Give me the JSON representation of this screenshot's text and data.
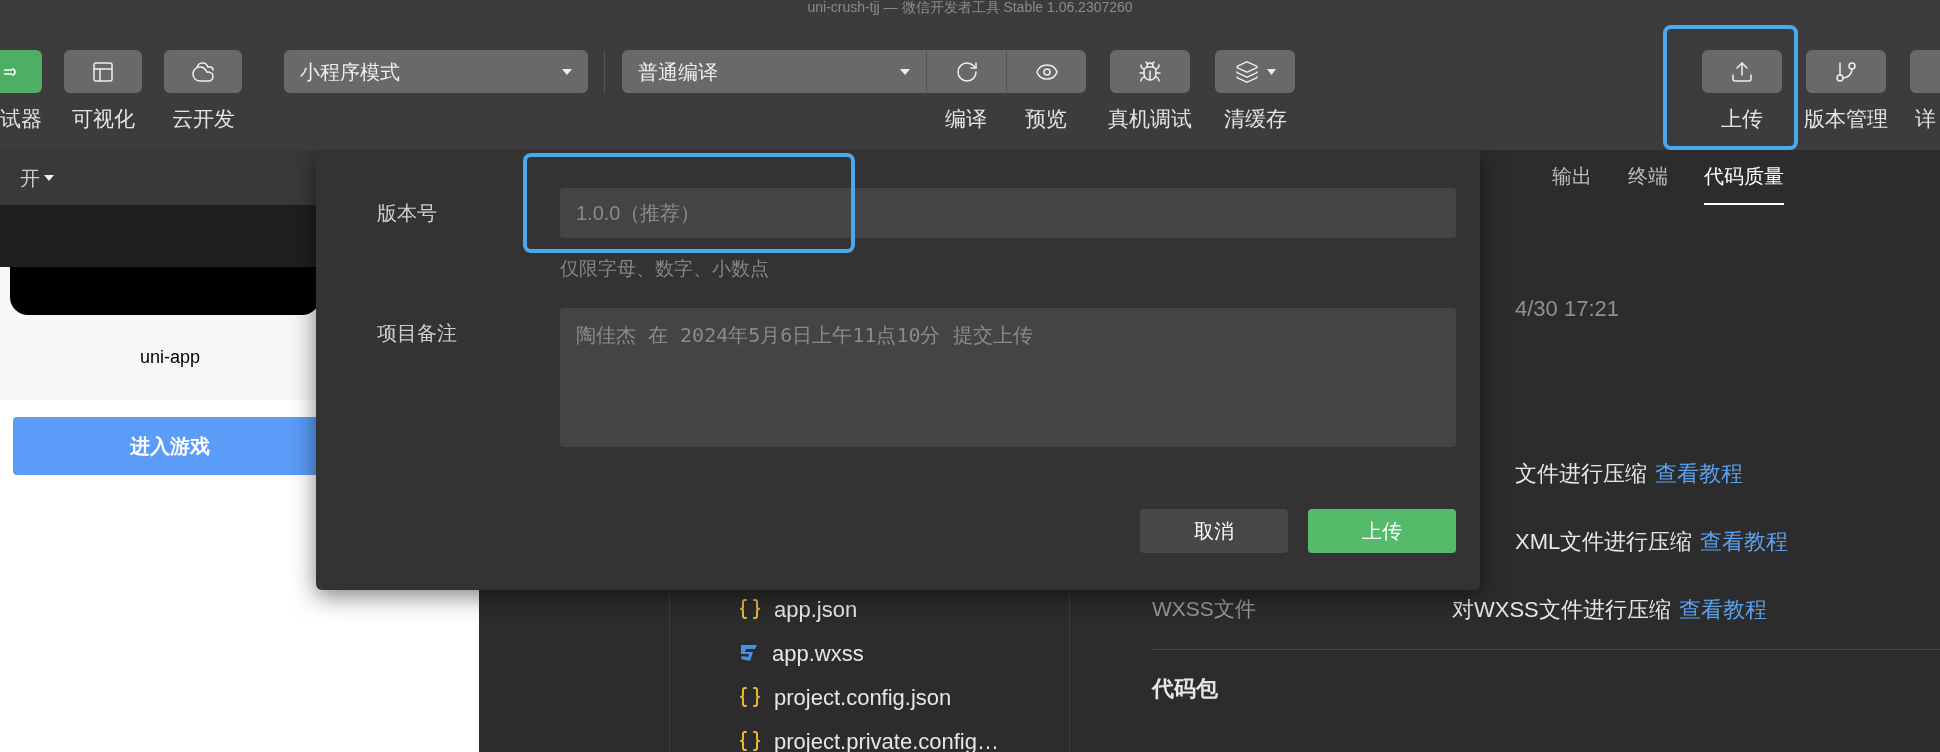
{
  "window": {
    "title": "uni-crush-tjj — 微信开发者工具 Stable 1.06.2307260"
  },
  "toolbar": {
    "left_buttons": [
      {
        "label": "试器",
        "kind": "debugger"
      },
      {
        "label": "可视化",
        "kind": "visual"
      },
      {
        "label": "云开发",
        "kind": "cloud"
      }
    ],
    "mode_select": {
      "value": "小程序模式"
    },
    "compile_select": {
      "value": "普通编译"
    },
    "actions": [
      {
        "label": "编译",
        "kind": "refresh"
      },
      {
        "label": "预览",
        "kind": "eye"
      },
      {
        "label": "真机调试",
        "kind": "bug"
      },
      {
        "label": "清缓存",
        "kind": "layers"
      }
    ],
    "right_buttons": [
      {
        "label": "上传",
        "kind": "upload",
        "highlighted": true
      },
      {
        "label": "版本管理",
        "kind": "branch",
        "highlighted": false
      },
      {
        "label": "详",
        "kind": "details",
        "highlighted": false
      }
    ]
  },
  "simulator": {
    "toolbar_text": "开",
    "app_title": "uni-app",
    "button": "进入游戏"
  },
  "upload_dialog": {
    "fields": [
      {
        "label": "版本号",
        "kind": "input",
        "placeholder": "1.0.0（推荐）",
        "hint": "仅限字母、数字、小数点",
        "highlighted": true
      },
      {
        "label": "项目备注",
        "kind": "textarea",
        "placeholder": "陶佳杰 在 2024年5月6日上午11点10分 提交上传",
        "highlighted": false
      }
    ],
    "buttons": [
      {
        "label": "取消",
        "kind": "secondary"
      },
      {
        "label": "上传",
        "kind": "primary"
      }
    ]
  },
  "file_tree": {
    "items": [
      {
        "name": "app.json",
        "kind": "json"
      },
      {
        "name": "app.wxss",
        "kind": "css"
      },
      {
        "name": "project.config.json",
        "kind": "json"
      },
      {
        "name": "project.private.config…",
        "kind": "json"
      }
    ]
  },
  "panel": {
    "tabs": [
      {
        "label": "输出",
        "selected": false
      },
      {
        "label": "终端",
        "selected": false
      },
      {
        "label": "代码质量",
        "selected": true
      }
    ],
    "time": "4/30 17:21",
    "rows": [
      {
        "value": "文件进行压缩",
        "link": "查看教程"
      },
      {
        "value": "XML文件进行压缩",
        "link": "查看教程"
      },
      {
        "label": "WXSS文件",
        "value": "对WXSS文件进行压缩",
        "link": "查看教程"
      }
    ],
    "section_title": "代码包"
  }
}
